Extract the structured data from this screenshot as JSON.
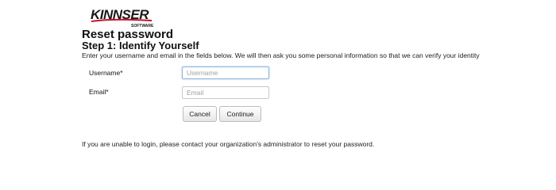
{
  "brand": {
    "name": "KINNSER",
    "tagline": "SOFTWARE"
  },
  "header": {
    "title": "Reset password",
    "step": "Step 1: Identify Yourself",
    "instructions": "Enter your username and email in the fields below. We will then ask you some personal information so that we can verify your identity"
  },
  "form": {
    "username": {
      "label": "Username*",
      "value": "",
      "placeholder": "Username"
    },
    "email": {
      "label": "Email*",
      "value": "",
      "placeholder": "Email"
    },
    "cancel_label": "Cancel",
    "continue_label": "Continue"
  },
  "footer": {
    "note": "If you are unable to login, please contact your organization's administrator to reset your password."
  },
  "colors": {
    "brand_red": "#c8102e",
    "brand_dark": "#1a1a1a",
    "focus_border": "#8fb6de"
  }
}
